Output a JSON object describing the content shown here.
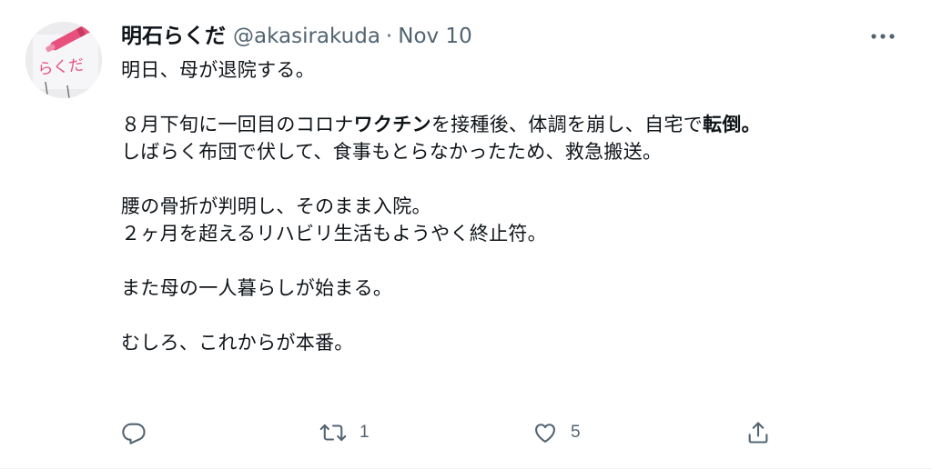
{
  "author": {
    "display_name": "明石らくだ",
    "handle": "@akasirakuda",
    "separator": "·",
    "date": "Nov 10",
    "avatar_doodle_text": "らくだ"
  },
  "tweet": {
    "line1": "明日、母が退院する。",
    "line3_part1": "８月下旬に一回目のコロナ",
    "line3_bold1": "ワクチン",
    "line3_part2": "を接種後、体調を崩し、自宅で",
    "line3_bold2": "転倒。",
    "line4": "しばらく布団で伏して、食事もとらなかったため、救急搬送。",
    "line6": "腰の骨折が判明し、そのまま入院。",
    "line7": "２ヶ月を超えるリハビリ生活もようやく終止符。",
    "line9": "また母の一人暮らしが始まる。",
    "line11": "むしろ、これからが本番。"
  },
  "actions": {
    "reply_count": "",
    "retweet_count": "1",
    "like_count": "5"
  },
  "icons": {
    "more": "more-horizontal-icon",
    "reply": "reply-icon",
    "retweet": "retweet-icon",
    "like": "heart-icon",
    "share": "share-icon"
  },
  "colors": {
    "text": "#0f1419",
    "secondary": "#536471",
    "avatar_marker": "#e8517e"
  }
}
